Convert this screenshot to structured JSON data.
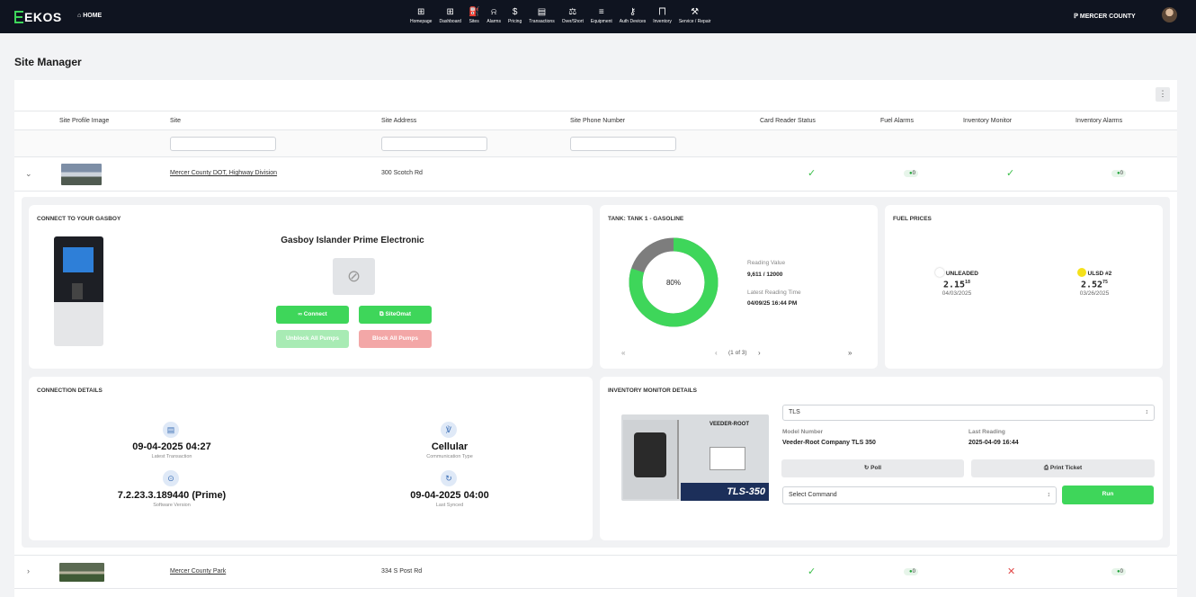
{
  "app": {
    "logo": "EKOS",
    "home": "HOME",
    "county": "MERCER COUNTY"
  },
  "nav": [
    {
      "label": "Homepage",
      "icon": "homepage-icon",
      "glyph": "⊞"
    },
    {
      "label": "Dashboard",
      "icon": "dashboard-icon",
      "glyph": "⊞"
    },
    {
      "label": "Sites",
      "icon": "sites-icon",
      "glyph": "⛽"
    },
    {
      "label": "Alarms",
      "icon": "bell-icon",
      "glyph": "⍾"
    },
    {
      "label": "Pricing",
      "icon": "dollar-icon",
      "glyph": "$"
    },
    {
      "label": "Transactions",
      "icon": "transactions-icon",
      "glyph": "▤"
    },
    {
      "label": "Over/Short",
      "icon": "scale-icon",
      "glyph": "⚖"
    },
    {
      "label": "Equipment",
      "icon": "layers-icon",
      "glyph": "≡"
    },
    {
      "label": "Auth Devices",
      "icon": "key-icon",
      "glyph": "⚷"
    },
    {
      "label": "Inventory",
      "icon": "chart-icon",
      "glyph": "⨅"
    },
    {
      "label": "Service / Repair",
      "icon": "tools-icon",
      "glyph": "⚒"
    }
  ],
  "page": {
    "title": "Site Manager"
  },
  "table": {
    "headers": [
      "Site Profile Image",
      "Site",
      "Site Address",
      "Site Phone Number",
      "Card Reader Status",
      "Fuel Alarms",
      "Inventory Monitor",
      "Inventory Alarms"
    ],
    "rows": [
      {
        "site": "Mercer County DOT, Highway Division",
        "address": "300 Scotch Rd",
        "fuel_alarms": "0",
        "inventory_alarms": "0",
        "expand": "⌄"
      },
      {
        "site": "Mercer County Park",
        "address": "334 S Post Rd",
        "fuel_alarms": "0",
        "inventory_alarms": "0",
        "expand": "›"
      }
    ]
  },
  "connect": {
    "title": "CONNECT TO YOUR GASBOY",
    "model": "Gasboy Islander Prime Electronic",
    "connect": "Connect",
    "siteomat": "SiteOmat",
    "unblock": "Unblock All Pumps",
    "block": "Block All Pumps"
  },
  "tank": {
    "title": "TANK: TANK 1 - GASOLINE",
    "percent_label": "80%",
    "fill_fraction": 0.8,
    "reading_label": "Reading Value",
    "reading": "9,611 / 12000",
    "time_label": "Latest Reading Time",
    "time": "04/09/25 16:44 PM",
    "pager": "(1 of 3)",
    "first": "«",
    "prev": "‹",
    "next": "›",
    "last": "»"
  },
  "fuel": {
    "title": "FUEL PRICES",
    "items": [
      {
        "name": "UNLEADED",
        "price": "2.15",
        "sup": "18",
        "date": "04/03/2025",
        "color": "#ffffff"
      },
      {
        "name": "ULSD #2",
        "price": "2.52",
        "sup": "75",
        "date": "03/26/2025",
        "color": "#f5e11b"
      }
    ]
  },
  "conn": {
    "title": "CONNECTION DETAILS",
    "latest": "09-04-2025 04:27",
    "latest_label": "Latest Transaction",
    "comm": "Cellular",
    "comm_label": "Communication Type",
    "sw": "7.2.23.3.189440 (Prime)",
    "sw_label": "Software Version",
    "synced": "09-04-2025 04:00",
    "synced_label": "Last Synced"
  },
  "inv": {
    "title": "INVENTORY MONITOR DETAILS",
    "device": "TLS",
    "model_label": "Model Number",
    "model": "Veeder-Root Company TLS 350",
    "last_label": "Last Reading",
    "last": "2025-04-09 16:44",
    "poll": "Poll",
    "print": "Print Ticket",
    "command": "Select Command",
    "run": "Run",
    "brand": "VEEDER-ROOT",
    "product": "TLS-350"
  }
}
